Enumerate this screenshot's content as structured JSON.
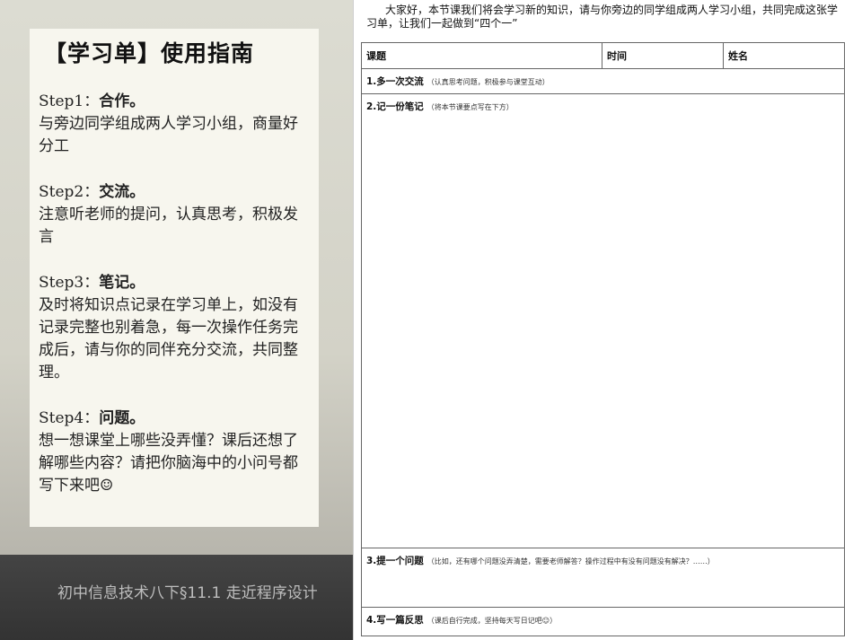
{
  "guide": {
    "title": "【学习单】使用指南",
    "steps": [
      {
        "label": "Step1：",
        "name": "合作。",
        "body": "与旁边同学组成两人学习小组，商量好分工"
      },
      {
        "label": "Step2：",
        "name": "交流。",
        "body": "注意听老师的提问，认真思考，积极发言"
      },
      {
        "label": "Step3：",
        "name": "笔记。",
        "body": "及时将知识点记录在学习单上，如没有记录完整也别着急，每一次操作任务完成后，请与你的同伴充分交流，共同整理。"
      },
      {
        "label": "Step4：",
        "name": "问题。",
        "body": "想一想课堂上哪些没弄懂？课后还想了解哪些内容？请把你脑海中的小问号都写下来吧☺"
      }
    ]
  },
  "footer": {
    "text": "初中信息技术八下§11.1 走近程序设计"
  },
  "worksheet": {
    "intro": "大家好，本节课我们将会学习新的知识，请与你旁边的同学组成两人学习小组，共同完成这张学习单，让我们一起做到“四个一”",
    "headers": {
      "topic": "课题",
      "time": "时间",
      "name": "姓名"
    },
    "sections": [
      {
        "title": "1.多一次交流",
        "note": "（认真思考问题，积极参与课堂互动）"
      },
      {
        "title": "2.记一份笔记",
        "note": "（将本节课要点写在下方）"
      },
      {
        "title": "3.提一个问题",
        "note": "（比如，还有哪个问题没弄清楚，需要老师解答？操作过程中有没有问题没有解决？……）"
      },
      {
        "title": "4.写一篇反思",
        "note": "（课后自行完成，坚持每天写日记吧☺）"
      }
    ]
  }
}
